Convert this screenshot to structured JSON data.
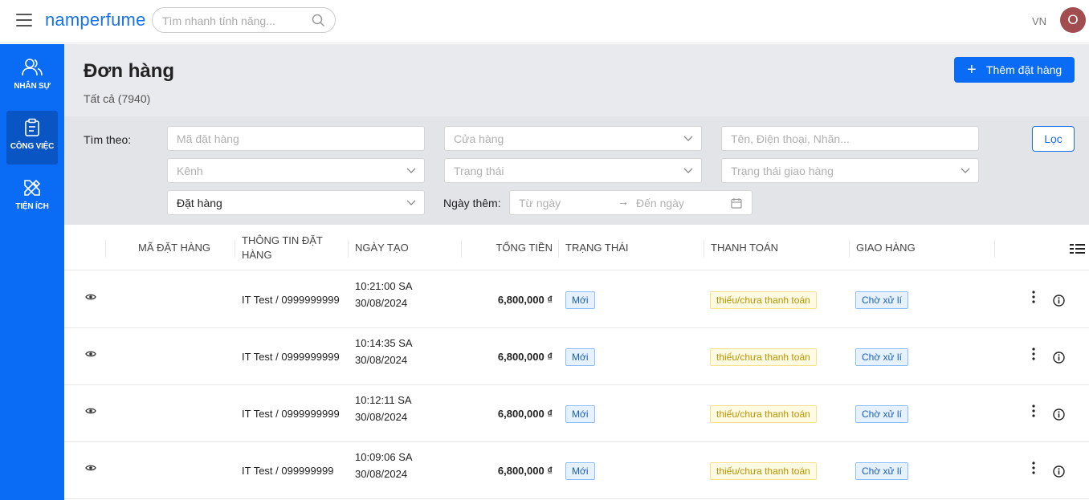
{
  "topbar": {
    "brand": "namperfume",
    "search_placeholder": "Tìm nhanh tính năng...",
    "language": "VN",
    "avatar_initial": "O"
  },
  "sidebar": {
    "items": [
      {
        "label": "NHÂN SỰ",
        "icon": "users-icon",
        "active": false
      },
      {
        "label": "CÔNG VIỆC",
        "icon": "clipboard-icon",
        "active": true
      },
      {
        "label": "TIỆN ÍCH",
        "icon": "tools-icon",
        "active": false
      }
    ]
  },
  "page": {
    "title": "Đơn hàng",
    "subtitle": "Tất cả (7940)",
    "add_button": "Thêm đặt hàng"
  },
  "filters": {
    "label": "Tìm theo:",
    "order_code_placeholder": "Mã đặt hàng",
    "store_placeholder": "Cửa hàng",
    "customer_placeholder": "Tên, Điện thoại, Nhãn...",
    "channel_placeholder": "Kênh",
    "status_placeholder": "Trạng thái",
    "shipping_status_placeholder": "Trạng thái giao hàng",
    "order_type_value": "Đặt hàng",
    "date_label": "Ngày thêm:",
    "from_placeholder": "Từ ngày",
    "to_placeholder": "Đến ngày",
    "filter_button": "Lọc"
  },
  "table": {
    "columns": {
      "order_code": "MÃ ĐẶT HÀNG",
      "order_info": "THÔNG TIN ĐẶT HÀNG",
      "created": "NGÀY TẠO",
      "total": "TỔNG TIỀN",
      "status": "TRẠNG THÁI",
      "payment": "THANH TOÁN",
      "shipping": "GIAO HÀNG"
    },
    "rows": [
      {
        "customer": "IT Test / 0999999999",
        "time": "10:21:00 SA",
        "date": "30/08/2024",
        "total": "6,800,000 ₫",
        "status": "Mới",
        "payment": "thiếu/chưa thanh toán",
        "shipping": "Chờ xử lí"
      },
      {
        "customer": "IT Test / 0999999999",
        "time": "10:14:35 SA",
        "date": "30/08/2024",
        "total": "6,800,000 ₫",
        "status": "Mới",
        "payment": "thiếu/chưa thanh toán",
        "shipping": "Chờ xử lí"
      },
      {
        "customer": "IT Test / 0999999999",
        "time": "10:12:11 SA",
        "date": "30/08/2024",
        "total": "6,800,000 ₫",
        "status": "Mới",
        "payment": "thiếu/chưa thanh toán",
        "shipping": "Chờ xử lí"
      },
      {
        "customer": "IT Test / 099999999",
        "time": "10:09:06 SA",
        "date": "30/08/2024",
        "total": "6,800,000 ₫",
        "status": "Mới",
        "payment": "thiếu/chưa thanh toán",
        "shipping": "Chờ xử lí"
      }
    ]
  },
  "colors": {
    "primary": "#0a6cf5",
    "sidebar_active": "#0a55c4",
    "avatar": "#a14d50",
    "payment_badge": "#fffbe3"
  }
}
